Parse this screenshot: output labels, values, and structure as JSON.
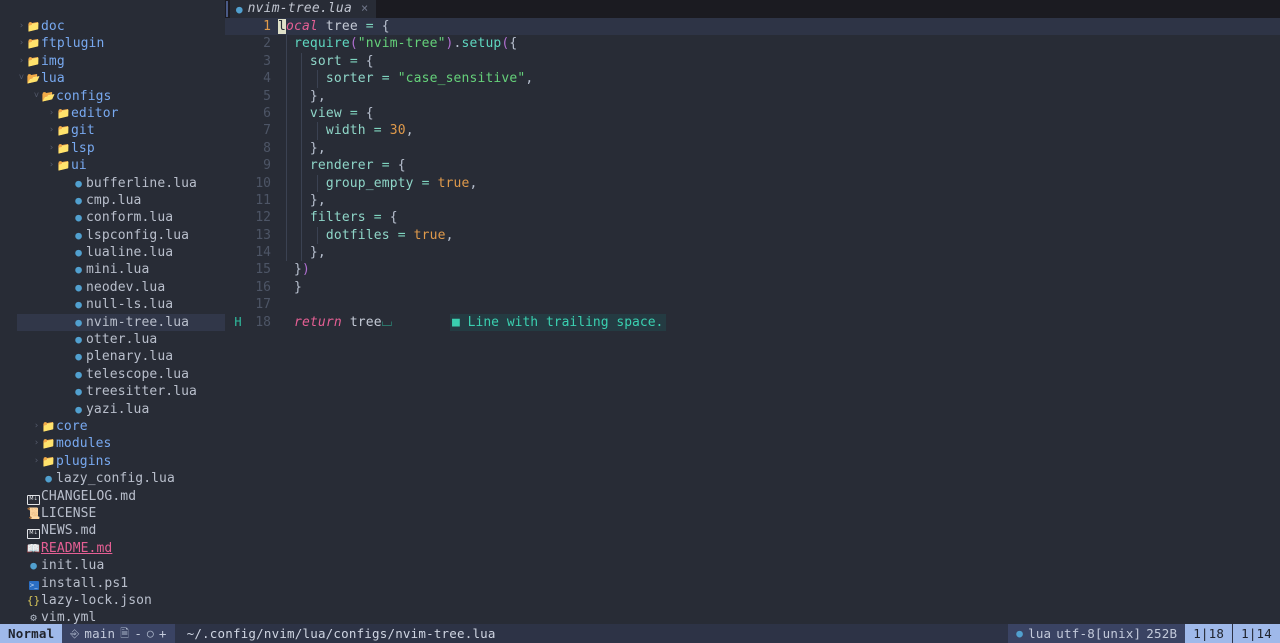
{
  "tabline": {
    "tabs": [
      {
        "icon": "lua-icon",
        "name": "nvim-tree.lua",
        "close": "×",
        "active": true
      }
    ]
  },
  "filetree": {
    "items": [
      {
        "indent": 0,
        "chev": "›",
        "type": "folder",
        "icon": "folder-closed-icon",
        "label": "doc"
      },
      {
        "indent": 0,
        "chev": "›",
        "type": "folder",
        "icon": "folder-closed-icon",
        "label": "ftplugin"
      },
      {
        "indent": 0,
        "chev": "›",
        "type": "folder",
        "icon": "folder-closed-icon",
        "label": "img"
      },
      {
        "indent": 0,
        "chev": "˅",
        "type": "folder",
        "icon": "folder-open-icon",
        "label": "lua"
      },
      {
        "indent": 1,
        "chev": "˅",
        "type": "folder",
        "icon": "folder-open-icon",
        "label": "configs"
      },
      {
        "indent": 2,
        "chev": "›",
        "type": "folder",
        "icon": "folder-closed-icon",
        "label": "editor"
      },
      {
        "indent": 2,
        "chev": "›",
        "type": "folder",
        "icon": "folder-closed-icon",
        "label": "git"
      },
      {
        "indent": 2,
        "chev": "›",
        "type": "folder",
        "icon": "folder-closed-icon",
        "label": "lsp"
      },
      {
        "indent": 2,
        "chev": "›",
        "type": "folder",
        "icon": "folder-closed-icon",
        "label": "ui"
      },
      {
        "indent": 3,
        "chev": "",
        "type": "lua",
        "icon": "lua-icon",
        "label": "bufferline.lua"
      },
      {
        "indent": 3,
        "chev": "",
        "type": "lua",
        "icon": "lua-icon",
        "label": "cmp.lua"
      },
      {
        "indent": 3,
        "chev": "",
        "type": "lua",
        "icon": "lua-icon",
        "label": "conform.lua"
      },
      {
        "indent": 3,
        "chev": "",
        "type": "lua",
        "icon": "lua-icon",
        "label": "lspconfig.lua"
      },
      {
        "indent": 3,
        "chev": "",
        "type": "lua",
        "icon": "lua-icon",
        "label": "lualine.lua"
      },
      {
        "indent": 3,
        "chev": "",
        "type": "lua",
        "icon": "lua-icon",
        "label": "mini.lua"
      },
      {
        "indent": 3,
        "chev": "",
        "type": "lua",
        "icon": "lua-icon",
        "label": "neodev.lua"
      },
      {
        "indent": 3,
        "chev": "",
        "type": "lua",
        "icon": "lua-icon",
        "label": "null-ls.lua"
      },
      {
        "indent": 3,
        "chev": "",
        "type": "lua",
        "icon": "lua-icon",
        "label": "nvim-tree.lua",
        "selected": true
      },
      {
        "indent": 3,
        "chev": "",
        "type": "lua",
        "icon": "lua-icon",
        "label": "otter.lua"
      },
      {
        "indent": 3,
        "chev": "",
        "type": "lua",
        "icon": "lua-icon",
        "label": "plenary.lua"
      },
      {
        "indent": 3,
        "chev": "",
        "type": "lua",
        "icon": "lua-icon",
        "label": "telescope.lua"
      },
      {
        "indent": 3,
        "chev": "",
        "type": "lua",
        "icon": "lua-icon",
        "label": "treesitter.lua"
      },
      {
        "indent": 3,
        "chev": "",
        "type": "lua",
        "icon": "lua-icon",
        "label": "yazi.lua"
      },
      {
        "indent": 1,
        "chev": "›",
        "type": "folder",
        "icon": "folder-closed-icon",
        "label": "core"
      },
      {
        "indent": 1,
        "chev": "›",
        "type": "folder",
        "icon": "folder-closed-icon",
        "label": "modules"
      },
      {
        "indent": 1,
        "chev": "›",
        "type": "folder",
        "icon": "folder-closed-icon",
        "label": "plugins"
      },
      {
        "indent": 1,
        "chev": "",
        "type": "lua",
        "icon": "lua-icon",
        "label": "lazy_config.lua"
      },
      {
        "indent": 0,
        "chev": "",
        "type": "md",
        "icon": "markdown-icon",
        "label": "CHANGELOG.md"
      },
      {
        "indent": 0,
        "chev": "",
        "type": "license",
        "icon": "license-icon",
        "label": "LICENSE"
      },
      {
        "indent": 0,
        "chev": "",
        "type": "md",
        "icon": "markdown-icon",
        "label": "NEWS.md"
      },
      {
        "indent": 0,
        "chev": "",
        "type": "readme",
        "icon": "book-icon",
        "label": "README.md"
      },
      {
        "indent": 0,
        "chev": "",
        "type": "lua",
        "icon": "lua-icon",
        "label": "init.lua"
      },
      {
        "indent": 0,
        "chev": "",
        "type": "ps1",
        "icon": "powershell-icon",
        "label": "install.ps1"
      },
      {
        "indent": 0,
        "chev": "",
        "type": "json",
        "icon": "json-icon",
        "label": "lazy-lock.json"
      },
      {
        "indent": 0,
        "chev": "",
        "type": "yml",
        "icon": "gear-icon",
        "label": "vim.yml"
      }
    ]
  },
  "editor": {
    "lines": [
      {
        "num": "1",
        "sign": "",
        "cursorline": true,
        "guides": 0,
        "tokens": [
          {
            "t": "l",
            "c": "cursor"
          },
          {
            "t": "ocal",
            "c": "kw"
          },
          {
            "t": " ",
            "c": "id"
          },
          {
            "t": "tree",
            "c": "id"
          },
          {
            "t": " ",
            "c": "id"
          },
          {
            "t": "=",
            "c": "op"
          },
          {
            "t": " ",
            "c": "id"
          },
          {
            "t": "{",
            "c": "punc"
          }
        ]
      },
      {
        "num": "2",
        "sign": "",
        "cursorline": false,
        "guides": 1,
        "tokens": [
          {
            "t": "  ",
            "c": "id"
          },
          {
            "t": "require",
            "c": "fn"
          },
          {
            "t": "(",
            "c": "paren"
          },
          {
            "t": "\"nvim-tree\"",
            "c": "str"
          },
          {
            "t": ")",
            "c": "paren"
          },
          {
            "t": ".",
            "c": "punc"
          },
          {
            "t": "setup",
            "c": "fn"
          },
          {
            "t": "(",
            "c": "paren"
          },
          {
            "t": "{",
            "c": "punc"
          }
        ]
      },
      {
        "num": "3",
        "sign": "",
        "cursorline": false,
        "guides": 2,
        "tokens": [
          {
            "t": "    ",
            "c": "id"
          },
          {
            "t": "sort",
            "c": "prop"
          },
          {
            "t": " ",
            "c": "id"
          },
          {
            "t": "=",
            "c": "op"
          },
          {
            "t": " ",
            "c": "id"
          },
          {
            "t": "{",
            "c": "punc"
          }
        ]
      },
      {
        "num": "4",
        "sign": "",
        "cursorline": false,
        "guides": 3,
        "tokens": [
          {
            "t": "      ",
            "c": "id"
          },
          {
            "t": "sorter",
            "c": "prop"
          },
          {
            "t": " ",
            "c": "id"
          },
          {
            "t": "=",
            "c": "op"
          },
          {
            "t": " ",
            "c": "id"
          },
          {
            "t": "\"case_sensitive\"",
            "c": "str"
          },
          {
            "t": ",",
            "c": "punc"
          }
        ]
      },
      {
        "num": "5",
        "sign": "",
        "cursorline": false,
        "guides": 2,
        "tokens": [
          {
            "t": "    ",
            "c": "id"
          },
          {
            "t": "}",
            "c": "punc"
          },
          {
            "t": ",",
            "c": "punc"
          }
        ]
      },
      {
        "num": "6",
        "sign": "",
        "cursorline": false,
        "guides": 2,
        "tokens": [
          {
            "t": "    ",
            "c": "id"
          },
          {
            "t": "view",
            "c": "prop"
          },
          {
            "t": " ",
            "c": "id"
          },
          {
            "t": "=",
            "c": "op"
          },
          {
            "t": " ",
            "c": "id"
          },
          {
            "t": "{",
            "c": "punc"
          }
        ]
      },
      {
        "num": "7",
        "sign": "",
        "cursorline": false,
        "guides": 3,
        "tokens": [
          {
            "t": "      ",
            "c": "id"
          },
          {
            "t": "width",
            "c": "prop"
          },
          {
            "t": " ",
            "c": "id"
          },
          {
            "t": "=",
            "c": "op"
          },
          {
            "t": " ",
            "c": "id"
          },
          {
            "t": "30",
            "c": "num"
          },
          {
            "t": ",",
            "c": "punc"
          }
        ]
      },
      {
        "num": "8",
        "sign": "",
        "cursorline": false,
        "guides": 2,
        "tokens": [
          {
            "t": "    ",
            "c": "id"
          },
          {
            "t": "}",
            "c": "punc"
          },
          {
            "t": ",",
            "c": "punc"
          }
        ]
      },
      {
        "num": "9",
        "sign": "",
        "cursorline": false,
        "guides": 2,
        "tokens": [
          {
            "t": "    ",
            "c": "id"
          },
          {
            "t": "renderer",
            "c": "prop"
          },
          {
            "t": " ",
            "c": "id"
          },
          {
            "t": "=",
            "c": "op"
          },
          {
            "t": " ",
            "c": "id"
          },
          {
            "t": "{",
            "c": "punc"
          }
        ]
      },
      {
        "num": "10",
        "sign": "",
        "cursorline": false,
        "guides": 3,
        "tokens": [
          {
            "t": "      ",
            "c": "id"
          },
          {
            "t": "group_empty",
            "c": "prop"
          },
          {
            "t": " ",
            "c": "id"
          },
          {
            "t": "=",
            "c": "op"
          },
          {
            "t": " ",
            "c": "id"
          },
          {
            "t": "true",
            "c": "bool"
          },
          {
            "t": ",",
            "c": "punc"
          }
        ]
      },
      {
        "num": "11",
        "sign": "",
        "cursorline": false,
        "guides": 2,
        "tokens": [
          {
            "t": "    ",
            "c": "id"
          },
          {
            "t": "}",
            "c": "punc"
          },
          {
            "t": ",",
            "c": "punc"
          }
        ]
      },
      {
        "num": "12",
        "sign": "",
        "cursorline": false,
        "guides": 2,
        "tokens": [
          {
            "t": "    ",
            "c": "id"
          },
          {
            "t": "filters",
            "c": "prop"
          },
          {
            "t": " ",
            "c": "id"
          },
          {
            "t": "=",
            "c": "op"
          },
          {
            "t": " ",
            "c": "id"
          },
          {
            "t": "{",
            "c": "punc"
          }
        ]
      },
      {
        "num": "13",
        "sign": "",
        "cursorline": false,
        "guides": 3,
        "tokens": [
          {
            "t": "      ",
            "c": "id"
          },
          {
            "t": "dotfiles",
            "c": "prop"
          },
          {
            "t": " ",
            "c": "id"
          },
          {
            "t": "=",
            "c": "op"
          },
          {
            "t": " ",
            "c": "id"
          },
          {
            "t": "true",
            "c": "bool"
          },
          {
            "t": ",",
            "c": "punc"
          }
        ]
      },
      {
        "num": "14",
        "sign": "",
        "cursorline": false,
        "guides": 2,
        "tokens": [
          {
            "t": "    ",
            "c": "id"
          },
          {
            "t": "}",
            "c": "punc"
          },
          {
            "t": ",",
            "c": "punc"
          }
        ]
      },
      {
        "num": "15",
        "sign": "",
        "cursorline": false,
        "guides": 0,
        "tokens": [
          {
            "t": "  ",
            "c": "id"
          },
          {
            "t": "}",
            "c": "punc"
          },
          {
            "t": ")",
            "c": "paren"
          }
        ]
      },
      {
        "num": "16",
        "sign": "",
        "cursorline": false,
        "guides": 0,
        "tokens": [
          {
            "t": "  ",
            "c": "id"
          },
          {
            "t": "}",
            "c": "punc"
          }
        ]
      },
      {
        "num": "17",
        "sign": "",
        "cursorline": false,
        "guides": 0,
        "tokens": []
      },
      {
        "num": "18",
        "sign": "H",
        "cursorline": false,
        "guides": 0,
        "tokens": [
          {
            "t": "  ",
            "c": "id"
          },
          {
            "t": "return",
            "c": "kw"
          },
          {
            "t": " ",
            "c": "id"
          },
          {
            "t": "tree",
            "c": "id"
          },
          {
            "t": "⌴",
            "c": "trailsp"
          }
        ],
        "diagnostic": "■ Line with trailing space."
      }
    ]
  },
  "statusline": {
    "mode": "Normal",
    "git_branch_icon": "git-branch-icon",
    "git_branch": "main",
    "git_diff_file_icon": "file-diff-icon",
    "git_diff_file_count": "-",
    "git_diff_clock_icon": "clock-icon",
    "git_diff_clock_count": "+",
    "path": "~/.config/nvim/lua/configs/nvim-tree.lua",
    "filetype_icon": "lua-icon",
    "filetype": "lua",
    "encoding": "utf-8[unix]",
    "filesize": "252B",
    "position_primary": "1|18",
    "position_secondary": "1|14"
  }
}
